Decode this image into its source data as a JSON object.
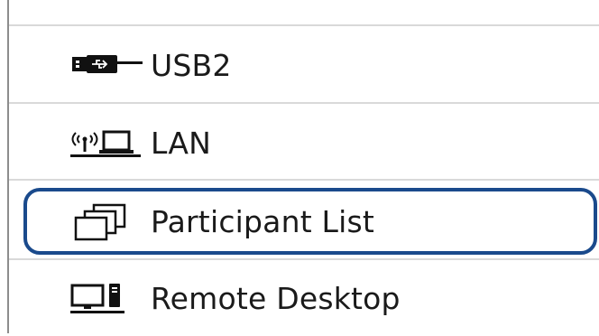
{
  "menu": {
    "items": [
      {
        "id": "usb2",
        "label": "USB2",
        "icon": "usb-cable-icon",
        "selected": false
      },
      {
        "id": "lan",
        "label": "LAN",
        "icon": "lan-network-icon",
        "selected": false
      },
      {
        "id": "participant-list",
        "label": "Participant List",
        "icon": "participant-windows-icon",
        "selected": true
      },
      {
        "id": "remote-desktop",
        "label": "Remote Desktop",
        "icon": "remote-desktop-icon",
        "selected": false
      }
    ]
  },
  "colors": {
    "selection_border": "#1a4a8c",
    "divider": "#d9d9d9",
    "text": "#1a1a1a"
  }
}
